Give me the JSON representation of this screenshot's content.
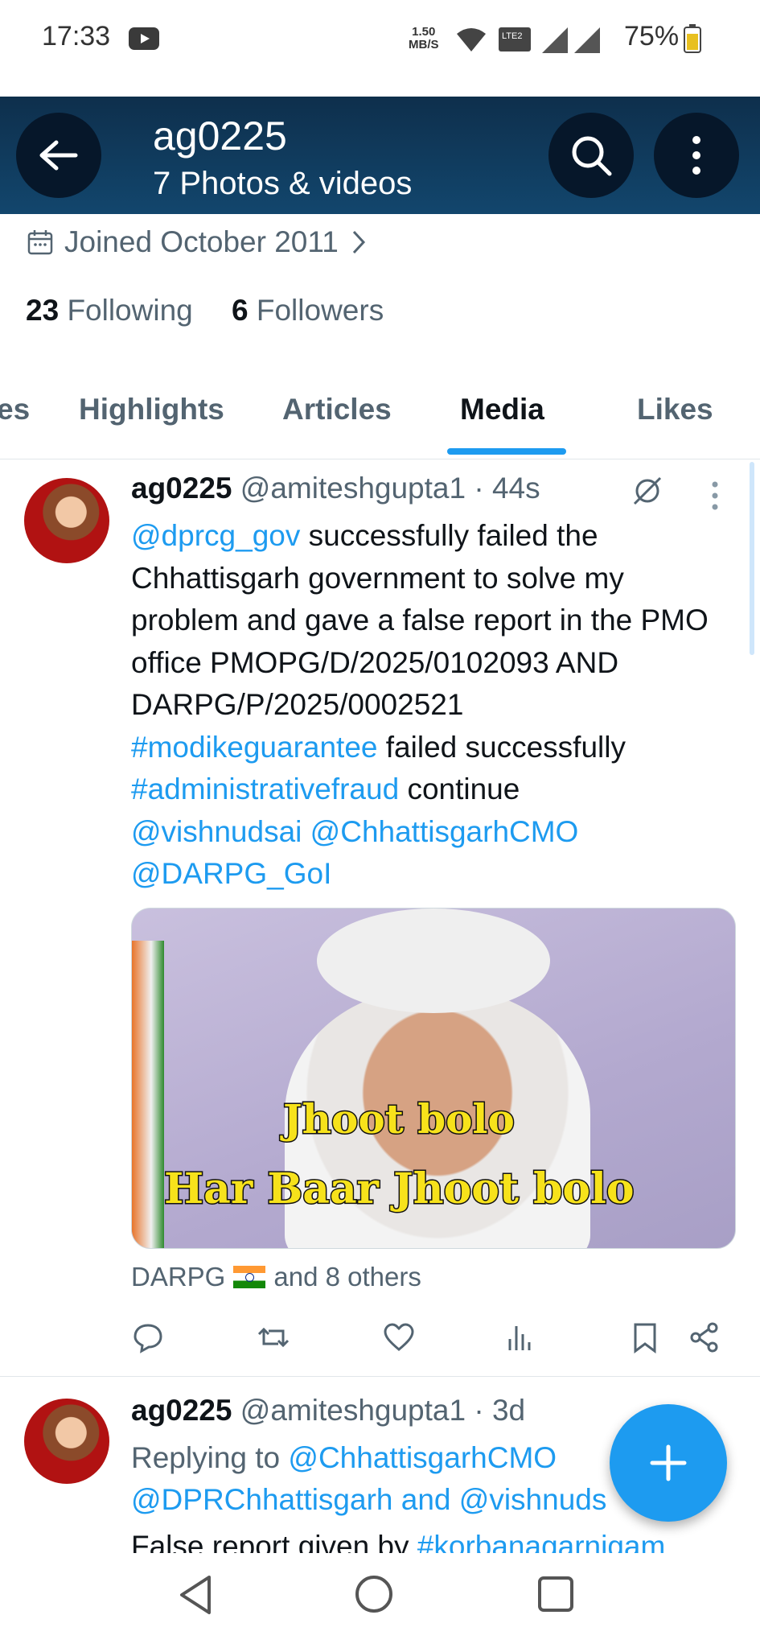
{
  "status_bar": {
    "time": "17:33",
    "speed_value": "1.50",
    "speed_unit": "MB/S",
    "network": "LTE2",
    "battery": "75%"
  },
  "header": {
    "title": "ag0225",
    "subtitle": "7 Photos & videos"
  },
  "profile": {
    "joined": "Joined October 2011",
    "following_count": "23",
    "following_label": "Following",
    "followers_count": "6",
    "followers_label": "Followers"
  },
  "tabs": [
    {
      "label": "es"
    },
    {
      "label": "Highlights"
    },
    {
      "label": "Articles"
    },
    {
      "label": "Media"
    },
    {
      "label": "Likes"
    }
  ],
  "tweets": [
    {
      "name": "ag0225",
      "handle": "@amiteshgupta1",
      "dot": "·",
      "time": "44s",
      "body": {
        "mention_1": "@dprcg_gov",
        "text_1": " successfully failed the Chhattisgarh government to solve my problem and gave a false report in the PMO office PMOPG/D/2025/0102093 AND DARPG/P/2025/0002521",
        "hashtag_1": "#modikeguarantee",
        "text_2": " failed successfully",
        "hashtag_2": "#administrativefraud",
        "text_3": " continue",
        "mention_2": "@vishnudsai",
        "mention_3": "@ChhattisgarhCMO",
        "mention_4": "@DARPG_GoI"
      },
      "media_caption_1": "Jhoot bolo",
      "media_caption_2": "Har Baar Jhoot bolo",
      "tagged_name": "DARPG",
      "tagged_rest": "and 8 others"
    },
    {
      "name": "ag0225",
      "handle": "@amiteshgupta1",
      "dot": "·",
      "time": "3d",
      "replying_prefix": "Replying to ",
      "replying_1": "@ChhattisgarhCMO",
      "replying_2": "@DPRChhattisgarh and @vishnuds",
      "text_prefix": "False report given by ",
      "text_tag": "#korbanagarnigam"
    }
  ],
  "colors": {
    "accent": "#1d9bf0",
    "header_bg": "#12466d",
    "text_secondary": "#536471"
  }
}
